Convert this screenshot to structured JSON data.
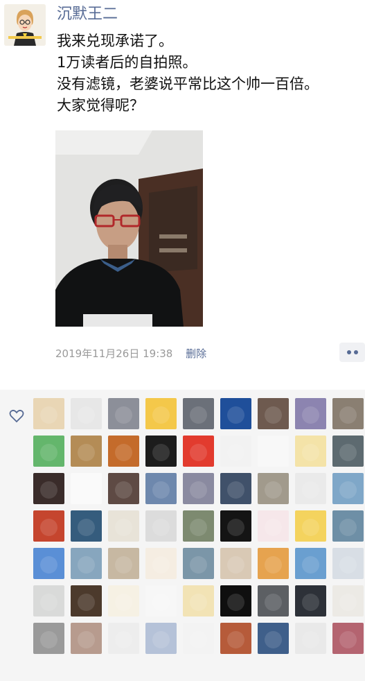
{
  "post": {
    "username": "沉默王二",
    "lines": [
      "我来兑现承诺了。",
      "1万读者后的自拍照。",
      "没有滤镜，老婆说平常比这个帅一百倍。",
      "大家觉得呢？"
    ],
    "timestamp": "2019年11月26日 19:38",
    "delete_label": "删除"
  },
  "likes": {
    "heart_icon": "heart-outline-icon",
    "avatar_colors": [
      "#e9d6b5",
      "#e7e7e7",
      "#8c8f99",
      "#f4c84a",
      "#6b7079",
      "#1f4f9a",
      "#6e5a4f",
      "#8c84b0",
      "#8a7f72",
      "#64b66c",
      "#b48c56",
      "#c46b2b",
      "#1c1c1c",
      "#e23b2e",
      "#f2f2f2",
      "#f8f8f8",
      "#f4e3a8",
      "#5d6a70",
      "#3a2c2a",
      "#fafafa",
      "#5e4a44",
      "#6e88ad",
      "#8a8aa0",
      "#40516a",
      "#a19a8c",
      "#eaeaea",
      "#7fa7c8",
      "#c5452e",
      "#355c7d",
      "#e8e3d8",
      "#dcdcdc",
      "#7d8a70",
      "#141414",
      "#f6e7ea",
      "#f4d35e",
      "#6e8fa6",
      "#5a8fd6",
      "#87a6be",
      "#c7b8a2",
      "#f5ede2",
      "#7b96a8",
      "#d9c9b5",
      "#e6a34f",
      "#6a9fd0",
      "#d8dee5",
      "#d9dad9",
      "#4c3a2c",
      "#f6f1e4",
      "#f7f7f7",
      "#f2e3b5",
      "#0f0f0f",
      "#5c5f63",
      "#2d3138",
      "#eceae5",
      "#9a9a9a",
      "#b79b8e",
      "#ededed",
      "#b5c2d8",
      "#f3f3f3",
      "#b65b3a",
      "#3f5f8a",
      "#e9e9e9",
      "#b46470"
    ]
  }
}
